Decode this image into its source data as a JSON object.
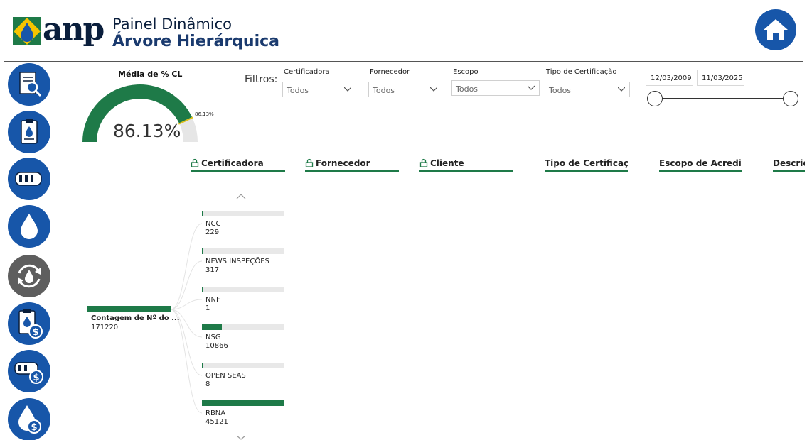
{
  "brand": {
    "logo_text": "anp"
  },
  "header": {
    "title": "Painel Dinâmico",
    "subtitle": "Árvore Hierárquica"
  },
  "colors": {
    "accent_blue": "#1756a9",
    "bar_green": "#1e7a48",
    "gauge_target": "#e0c21c"
  },
  "sidebar": {
    "items": [
      {
        "icon": "document-search-icon"
      },
      {
        "icon": "clipboard-drop-icon"
      },
      {
        "icon": "tank-truck-icon"
      },
      {
        "icon": "drop-icon"
      },
      {
        "icon": "recycle-drop-icon"
      },
      {
        "icon": "clipboard-dollar-icon"
      },
      {
        "icon": "tank-dollar-icon"
      },
      {
        "icon": "drop-dollar-icon"
      }
    ]
  },
  "gauge": {
    "title": "Média de % CL",
    "value_label": "86.13%",
    "target_label": "86.13%",
    "value": 0.8613
  },
  "filters": {
    "label": "Filtros:",
    "items": [
      {
        "label": "Certificadora",
        "value": "Todos"
      },
      {
        "label": "Fornecedor",
        "value": "Todos"
      },
      {
        "label": "Escopo",
        "value": "Todos"
      },
      {
        "label": "Tipo de Certificação",
        "value": "Todos"
      }
    ],
    "date_start": "12/03/2009",
    "date_end": "11/03/2025"
  },
  "tree": {
    "headers": [
      {
        "label": "Certificadora",
        "locked": true
      },
      {
        "label": "Fornecedor",
        "locked": true
      },
      {
        "label": "Cliente",
        "locked": true
      },
      {
        "label": "Tipo de Certificaç…",
        "closable": true
      },
      {
        "label": "Escopo de Acredi…",
        "closable": true
      },
      {
        "label": "Descriç"
      }
    ],
    "root": {
      "label": "Contagem de Nº do ...",
      "value": "171220"
    },
    "nodes": [
      {
        "name": "NCC",
        "value": "229",
        "count": 229
      },
      {
        "name": "NEWS INSPEÇÕES",
        "value": "317",
        "count": 317
      },
      {
        "name": "NNF",
        "value": "1",
        "count": 1
      },
      {
        "name": "NSG",
        "value": "10866",
        "count": 10866
      },
      {
        "name": "OPEN SEAS",
        "value": "8",
        "count": 8
      },
      {
        "name": "RBNA",
        "value": "45121",
        "count": 45121
      }
    ]
  }
}
